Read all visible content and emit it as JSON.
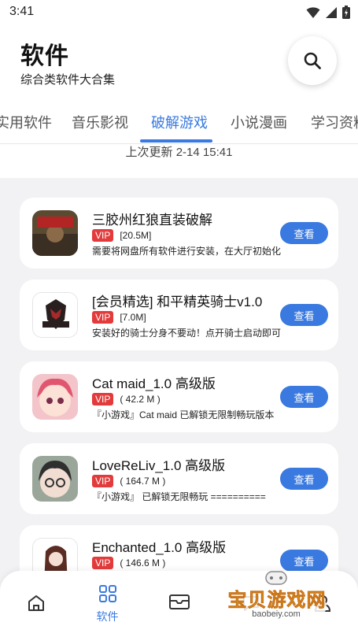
{
  "status_bar": {
    "time": "3:41",
    "icons": [
      "wifi-icon",
      "signal-icon",
      "battery-icon"
    ]
  },
  "header": {
    "title": "软件",
    "subtitle": "综合类软件大合集",
    "search_icon": "search-icon"
  },
  "tabs": [
    {
      "label": "实用软件",
      "active": false
    },
    {
      "label": "音乐影视",
      "active": false
    },
    {
      "label": "破解游戏",
      "active": true
    },
    {
      "label": "小说漫画",
      "active": false
    },
    {
      "label": "学习资料",
      "active": false
    }
  ],
  "updated_text": "上次更新 2-14 15:41",
  "cards": [
    {
      "title": "三胶州红狼直装破解",
      "badge": "VIP",
      "size": "[20.5M]",
      "desc": "需要将网盘所有软件进行安装，在大厅初始化",
      "button": "查看"
    },
    {
      "title": "[会员精选] 和平精英骑士v1.0",
      "badge": "VIP",
      "size": "[7.0M]",
      "desc": "安装好的骑士分身不要动！点开骑士启动即可",
      "button": "查看"
    },
    {
      "title": "Cat maid_1.0 高级版",
      "badge": "VIP",
      "size": "( 42.2 M )",
      "desc": "『小游戏』Cat maid  已解锁无限制畅玩版本",
      "button": "查看"
    },
    {
      "title": "LoveReLiv_1.0 高级版",
      "badge": "VIP",
      "size": "( 164.7 M )",
      "desc": "『小游戏』  已解锁无限畅玩  ==========",
      "button": "查看"
    },
    {
      "title": "Enchanted_1.0 高级版",
      "badge": "VIP",
      "size": "( 146.6 M )",
      "desc": "",
      "button": "查看"
    }
  ],
  "bottom_nav": [
    {
      "icon": "home-icon",
      "label": "",
      "active": false
    },
    {
      "icon": "grid-icon",
      "label": "软件",
      "active": true
    },
    {
      "icon": "mail-icon",
      "label": "",
      "active": false
    },
    {
      "icon": "chat-icon",
      "label": "",
      "active": false
    },
    {
      "icon": "user-icon",
      "label": "",
      "active": false
    }
  ],
  "watermark": {
    "text": "宝贝游戏网",
    "url": "baobeiy.com"
  },
  "colors": {
    "accent": "#3a7ae0",
    "vip": "#e33b3b",
    "background": "#f2f2f4"
  }
}
